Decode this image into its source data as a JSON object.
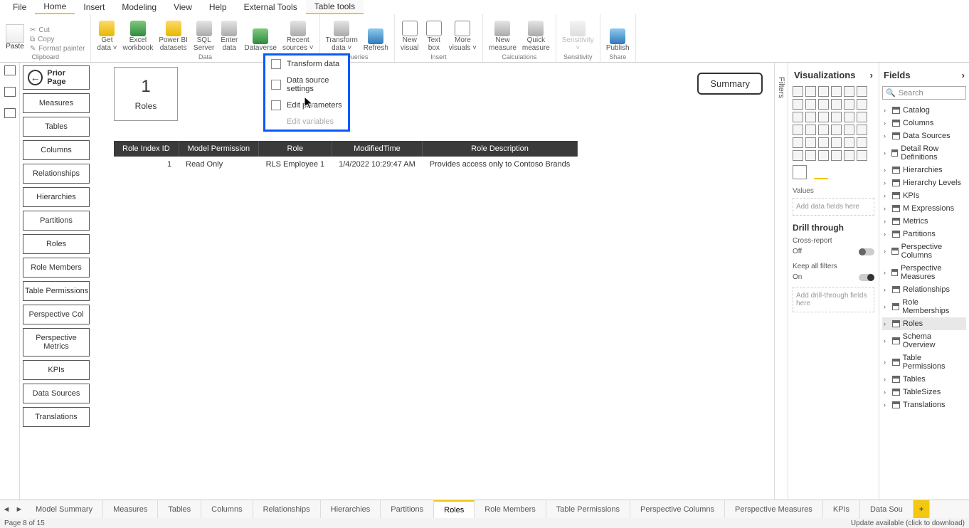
{
  "menu": {
    "tabs": [
      "File",
      "Home",
      "Insert",
      "Modeling",
      "View",
      "Help",
      "External Tools",
      "Table tools"
    ],
    "active_main": "Home",
    "active_context": "Table tools"
  },
  "ribbon": {
    "clipboard": {
      "paste": "Paste",
      "cut": "Cut",
      "copy": "Copy",
      "format_painter": "Format painter",
      "group": "Clipboard"
    },
    "data": {
      "get": "Get\ndata ˅",
      "excel": "Excel\nworkbook",
      "pbi": "Power BI\ndatasets",
      "sql": "SQL\nServer",
      "enter": "Enter\ndata",
      "dataverse": "Dataverse",
      "recent": "Recent\nsources ˅",
      "group": "Data"
    },
    "queries": {
      "transform": "Transform\ndata ˅",
      "refresh": "Refresh",
      "group": "Queries"
    },
    "insert": {
      "new_visual": "New\nvisual",
      "text_box": "Text\nbox",
      "more_vis": "More\nvisuals ˅",
      "group": "Insert"
    },
    "calc": {
      "new_measure": "New\nmeasure",
      "quick_measure": "Quick\nmeasure",
      "group": "Calculations"
    },
    "sens": {
      "label": "Sensitivity\n˅",
      "group": "Sensitivity"
    },
    "share": {
      "publish": "Publish",
      "group": "Share"
    }
  },
  "dropdown": {
    "items": [
      "Transform data",
      "Data source settings",
      "Edit parameters",
      "Edit variables"
    ],
    "disabled_index": 3
  },
  "nav": {
    "prior": "Prior Page",
    "buttons": [
      "Measures",
      "Tables",
      "Columns",
      "Relationships",
      "Hierarchies",
      "Partitions",
      "Roles",
      "Role Members",
      "Table Permissions",
      "Perspective Col",
      "Perspective\nMetrics",
      "KPIs",
      "Data Sources",
      "Translations"
    ]
  },
  "card": {
    "value": "1",
    "label": "Roles"
  },
  "summary_btn": "Summary",
  "table": {
    "headers": [
      "Role Index ID",
      "Model Permission",
      "Role",
      "ModifiedTime",
      "Role Description"
    ],
    "row": {
      "idx": "1",
      "perm": "Read Only",
      "role": "RLS Employee 1",
      "time": "1/4/2022 10:29:47 AM",
      "desc": "Provides access only to Contoso Brands"
    }
  },
  "filters_label": "Filters",
  "viz": {
    "title": "Visualizations",
    "values_lbl": "Values",
    "well1": "Add data fields here",
    "drill": "Drill through",
    "cross": "Cross-report",
    "cross_state": "Off",
    "keep": "Keep all filters",
    "keep_state": "On",
    "well2": "Add drill-through fields here"
  },
  "fields": {
    "title": "Fields",
    "search": "Search",
    "items": [
      "Catalog",
      "Columns",
      "Data Sources",
      "Detail Row Definitions",
      "Hierarchies",
      "Hierarchy Levels",
      "KPIs",
      "M Expressions",
      "Metrics",
      "Partitions",
      "Perspective Columns",
      "Perspective Measures",
      "Relationships",
      "Role Memberships",
      "Roles",
      "Schema Overview",
      "Table Permissions",
      "Tables",
      "TableSizes",
      "Translations"
    ],
    "selected": "Roles"
  },
  "pages": {
    "tabs": [
      "Model Summary",
      "Measures",
      "Tables",
      "Columns",
      "Relationships",
      "Hierarchies",
      "Partitions",
      "Roles",
      "Role Members",
      "Table Permissions",
      "Perspective Columns",
      "Perspective Measures",
      "KPIs",
      "Data Sou"
    ],
    "active": "Roles"
  },
  "status": {
    "left": "Page 8 of 15",
    "right": "Update available (click to download)"
  }
}
